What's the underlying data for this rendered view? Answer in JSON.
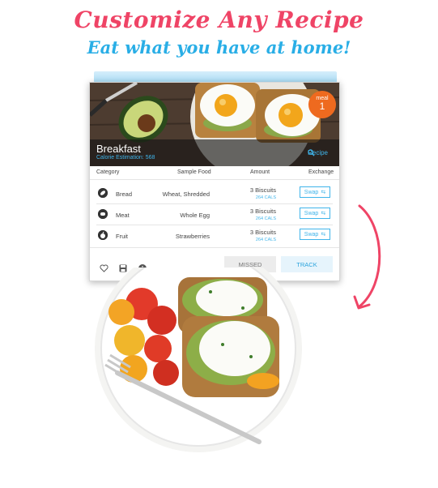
{
  "headline": {
    "line1": "Customize Any Recipe",
    "line2": "Eat what you have at home!"
  },
  "card": {
    "title": "Breakfast",
    "calorie_estimation": "Calorie Estimation: 568",
    "recipe_link": "Recipe",
    "meal_badge": {
      "label": "meal",
      "number": "1"
    },
    "columns": {
      "category": "Category",
      "sample_food": "Sample Food",
      "amount": "Amount",
      "exchange": "Exchange"
    },
    "rows": [
      {
        "category": "Bread",
        "food": "Wheat, Shredded",
        "amount": "3 Biscuits",
        "cals": "264 CALS",
        "swap": "Swap",
        "icon": "bread-icon"
      },
      {
        "category": "Meat",
        "food": "Whole Egg",
        "amount": "3 Biscuits",
        "cals": "264 CALS",
        "swap": "Swap",
        "icon": "meat-icon"
      },
      {
        "category": "Fruit",
        "food": "Strawberries",
        "amount": "3 Biscuits",
        "cals": "264 CALS",
        "swap": "Swap",
        "icon": "fruit-icon"
      }
    ],
    "footer": {
      "missed": "MISSED",
      "track": "TRACK"
    }
  },
  "colors": {
    "accent_pink": "#ef4466",
    "accent_blue": "#29aee6",
    "badge_orange": "#ee6a1f"
  }
}
